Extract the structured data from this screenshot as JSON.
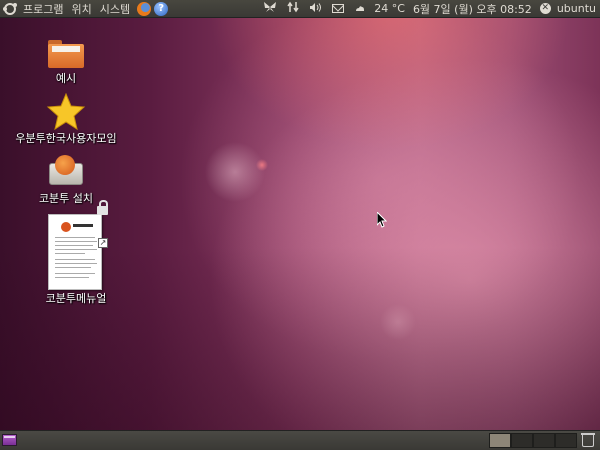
{
  "top_panel": {
    "menus": [
      "프로그램",
      "위치",
      "시스템"
    ],
    "launchers": [
      "firefox-icon",
      "help-icon"
    ],
    "help_glyph": "?",
    "tray": {
      "weather": "24 °C",
      "datetime": "6월  7일 (월) 오후 08:52",
      "user": "ubuntu",
      "session_glyph": "✕"
    }
  },
  "desktop": {
    "icons": [
      {
        "label": "예시",
        "icon": "folder-icon"
      },
      {
        "label": "우분투한국사용자모임",
        "icon": "star-icon"
      },
      {
        "label": "코분투 설치",
        "icon": "installer-icon"
      },
      {
        "label": "코분투메뉴얼",
        "icon": "document-icon"
      }
    ]
  },
  "bottom_panel": {
    "workspace_count": 4,
    "active_workspace": 1
  },
  "colors": {
    "panel": "#3a3935",
    "wallpaper_accent": "#a8587c",
    "folder": "#f39a4f",
    "star": "#f7c628"
  }
}
